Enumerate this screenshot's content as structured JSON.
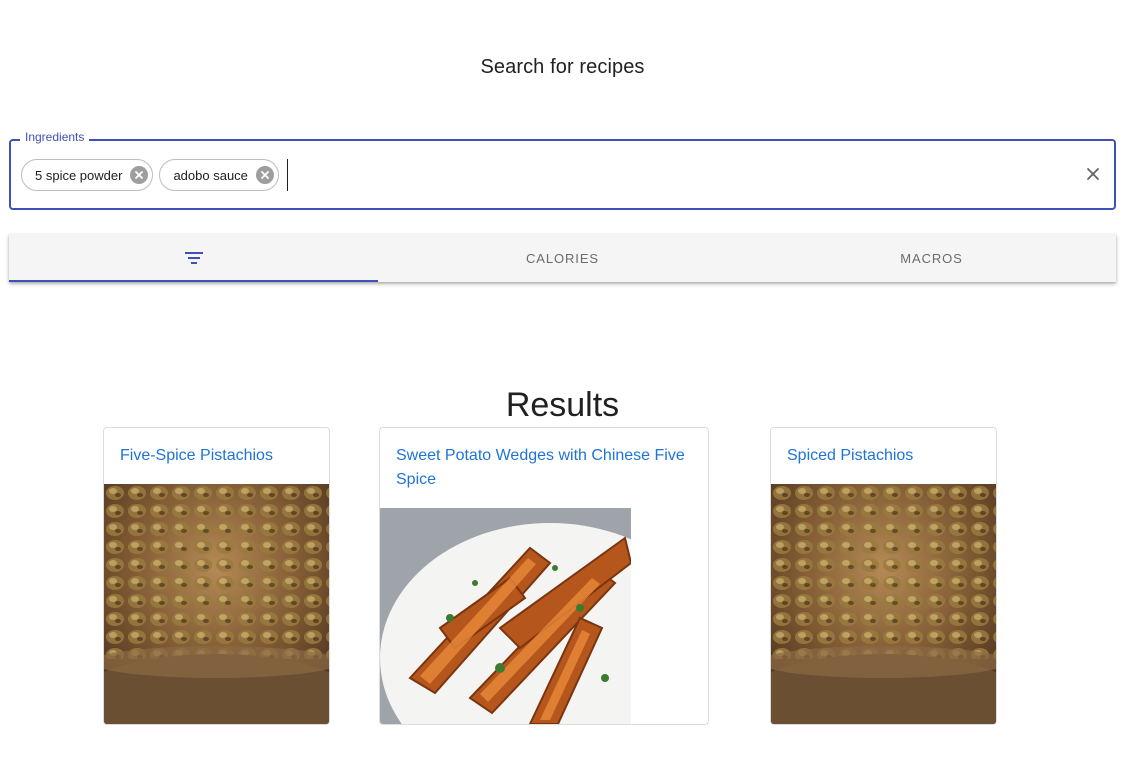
{
  "header": {
    "title": "Search for recipes"
  },
  "search": {
    "label": "Ingredients",
    "chips": [
      {
        "label": "5 spice powder"
      },
      {
        "label": "adobo sauce"
      }
    ],
    "clear_icon": "close-icon"
  },
  "tabs": [
    {
      "icon": "filter-icon",
      "label": "",
      "active": true
    },
    {
      "label": "CALORIES",
      "active": false
    },
    {
      "label": "MACROS",
      "active": false
    }
  ],
  "results": {
    "title": "Results",
    "cards": [
      {
        "title": "Five-Spice Pistachios",
        "image": "pistachios-in-bowl"
      },
      {
        "title": "Sweet Potato Wedges with Chinese Five Spice",
        "image": "sweet-potato-wedges-on-plate"
      },
      {
        "title": "Spiced Pistachios",
        "image": "pistachios-in-bowl"
      }
    ]
  },
  "colors": {
    "accent": "#3f51b5",
    "link": "#1e74d6",
    "tab_bg": "#f5f5f5"
  }
}
